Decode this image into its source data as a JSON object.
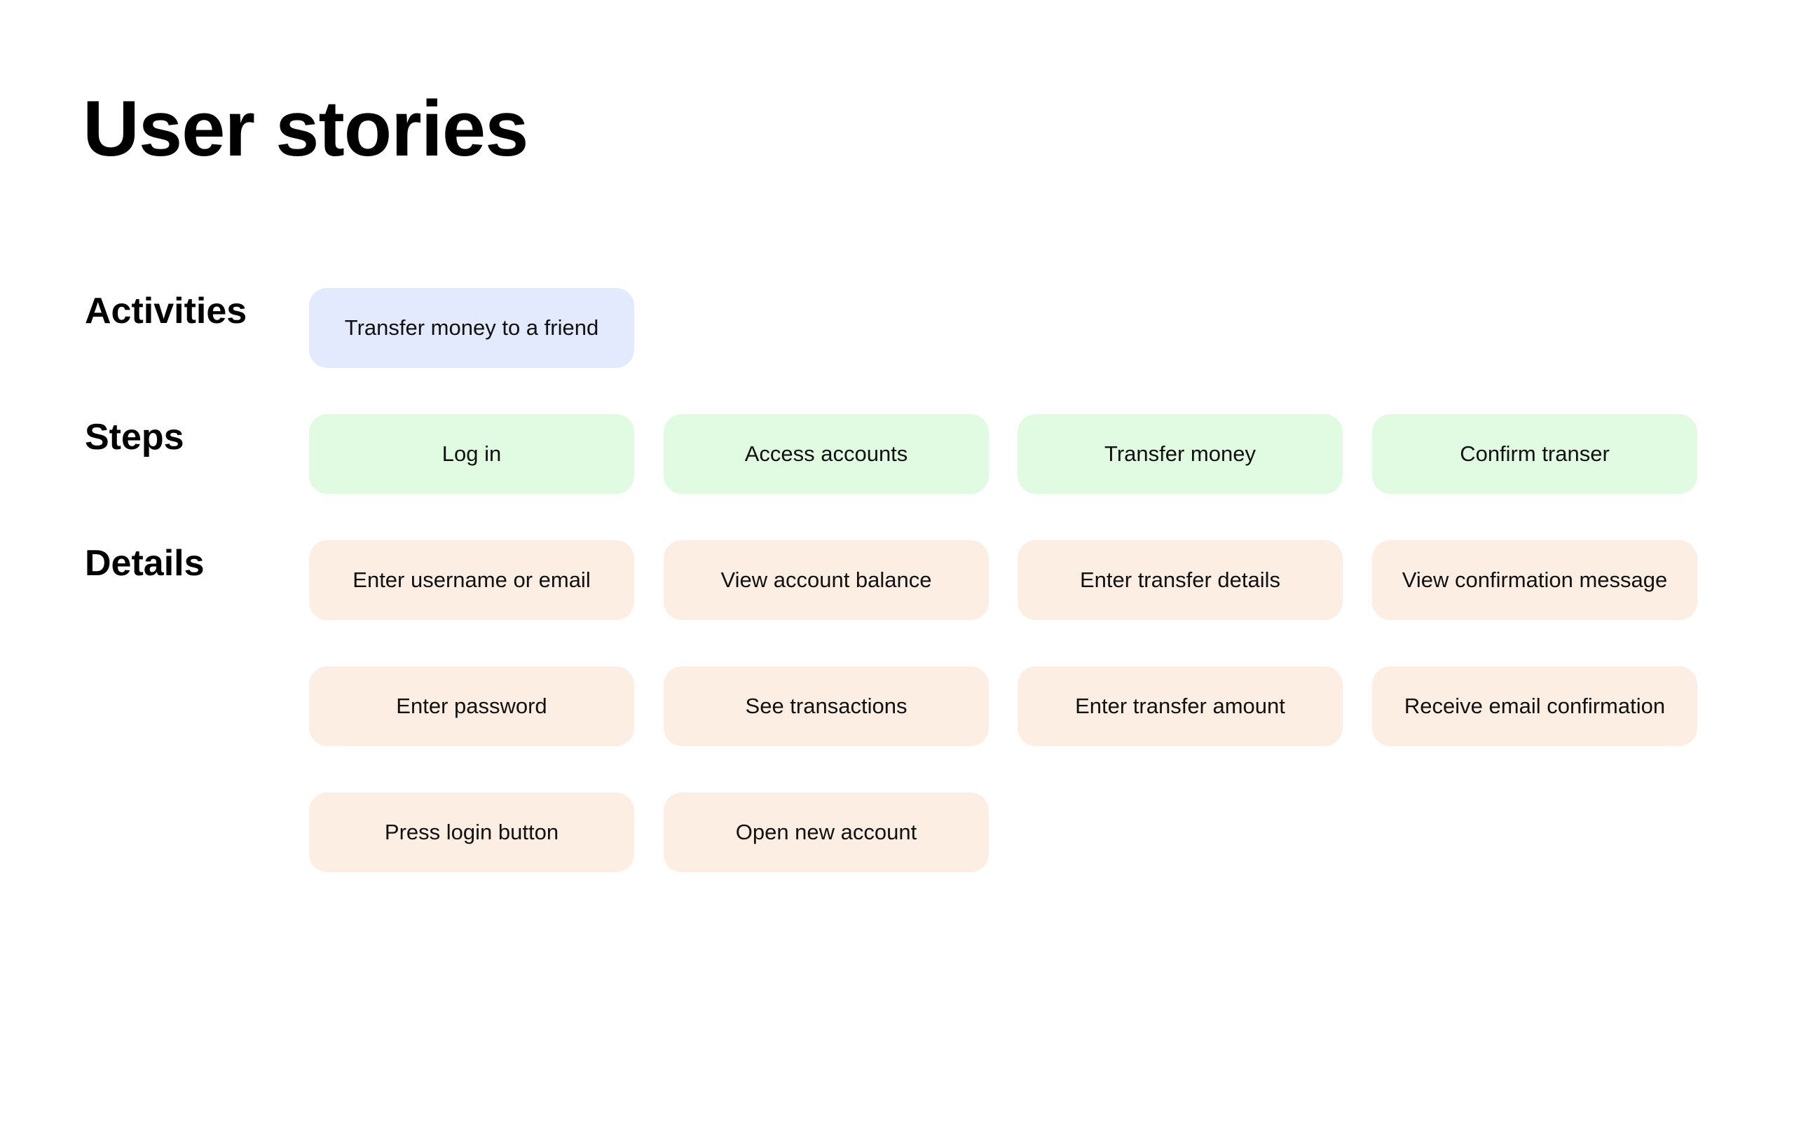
{
  "title": "User stories",
  "rows": {
    "activities": {
      "label": "Activities",
      "items": [
        "Transfer money to a friend"
      ]
    },
    "steps": {
      "label": "Steps",
      "items": [
        "Log in",
        "Access accounts",
        "Transfer money",
        "Confirm transer"
      ]
    },
    "details": {
      "label": "Details",
      "columns": [
        [
          "Enter username or email",
          "Enter password",
          "Press login button"
        ],
        [
          "View account balance",
          "See transactions",
          "Open new account"
        ],
        [
          "Enter transfer details",
          "Enter transfer amount"
        ],
        [
          "View confirmation message",
          "Receive email confirmation"
        ]
      ]
    }
  },
  "colors": {
    "activity": "#E3EAFD",
    "step": "#E1FBE3",
    "detail": "#FDEEE3"
  }
}
